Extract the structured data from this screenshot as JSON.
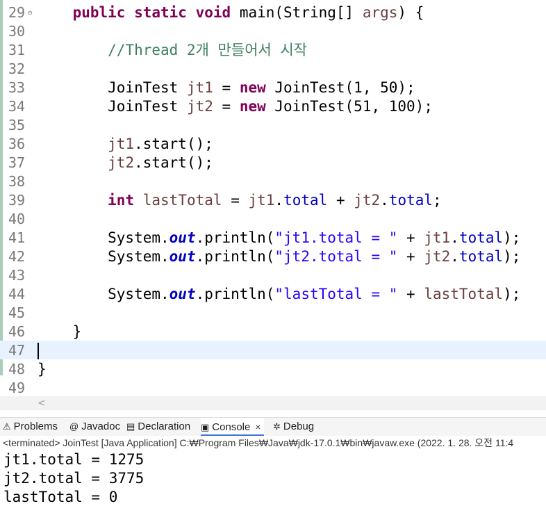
{
  "editor": {
    "lines": [
      {
        "num": "29",
        "folded": true,
        "tokens": [
          [
            "p",
            "    "
          ],
          [
            "kw",
            "public"
          ],
          [
            "p",
            " "
          ],
          [
            "kw",
            "static"
          ],
          [
            "p",
            " "
          ],
          [
            "kw",
            "void"
          ],
          [
            "p",
            " main(String[] "
          ],
          [
            "var",
            "args"
          ],
          [
            "p",
            ") {"
          ]
        ]
      },
      {
        "num": "30",
        "tokens": []
      },
      {
        "num": "31",
        "tokens": [
          [
            "p",
            "        "
          ],
          [
            "cmt",
            "//Thread 2개 만들어서 시작"
          ]
        ]
      },
      {
        "num": "32",
        "tokens": []
      },
      {
        "num": "33",
        "tokens": [
          [
            "p",
            "        JoinTest "
          ],
          [
            "var",
            "jt1"
          ],
          [
            "p",
            " = "
          ],
          [
            "kw",
            "new"
          ],
          [
            "p",
            " JoinTest(1, 50);"
          ]
        ]
      },
      {
        "num": "34",
        "tokens": [
          [
            "p",
            "        JoinTest "
          ],
          [
            "var",
            "jt2"
          ],
          [
            "p",
            " = "
          ],
          [
            "kw",
            "new"
          ],
          [
            "p",
            " JoinTest(51, 100);"
          ]
        ]
      },
      {
        "num": "35",
        "tokens": []
      },
      {
        "num": "36",
        "tokens": [
          [
            "p",
            "        "
          ],
          [
            "var",
            "jt1"
          ],
          [
            "p",
            ".start();"
          ]
        ]
      },
      {
        "num": "37",
        "tokens": [
          [
            "p",
            "        "
          ],
          [
            "var",
            "jt2"
          ],
          [
            "p",
            ".start();"
          ]
        ]
      },
      {
        "num": "38",
        "tokens": []
      },
      {
        "num": "39",
        "tokens": [
          [
            "p",
            "        "
          ],
          [
            "kw",
            "int"
          ],
          [
            "p",
            " "
          ],
          [
            "var",
            "lastTotal"
          ],
          [
            "p",
            " = "
          ],
          [
            "var",
            "jt1"
          ],
          [
            "p",
            "."
          ],
          [
            "fld",
            "total"
          ],
          [
            "p",
            " + "
          ],
          [
            "var",
            "jt2"
          ],
          [
            "p",
            "."
          ],
          [
            "fld",
            "total"
          ],
          [
            "p",
            ";"
          ]
        ]
      },
      {
        "num": "40",
        "tokens": []
      },
      {
        "num": "41",
        "tokens": [
          [
            "p",
            "        System."
          ],
          [
            "sfld",
            "out"
          ],
          [
            "p",
            ".println("
          ],
          [
            "str",
            "\"jt1.total = \""
          ],
          [
            "p",
            " + "
          ],
          [
            "var",
            "jt1"
          ],
          [
            "p",
            "."
          ],
          [
            "fld",
            "total"
          ],
          [
            "p",
            ");"
          ]
        ]
      },
      {
        "num": "42",
        "tokens": [
          [
            "p",
            "        System."
          ],
          [
            "sfld",
            "out"
          ],
          [
            "p",
            ".println("
          ],
          [
            "str",
            "\"jt2.total = \""
          ],
          [
            "p",
            " + "
          ],
          [
            "var",
            "jt2"
          ],
          [
            "p",
            "."
          ],
          [
            "fld",
            "total"
          ],
          [
            "p",
            ");"
          ]
        ]
      },
      {
        "num": "43",
        "tokens": []
      },
      {
        "num": "44",
        "tokens": [
          [
            "p",
            "        System."
          ],
          [
            "sfld",
            "out"
          ],
          [
            "p",
            ".println("
          ],
          [
            "str",
            "\"lastTotal = \""
          ],
          [
            "p",
            " + "
          ],
          [
            "var",
            "lastTotal"
          ],
          [
            "p",
            ");"
          ]
        ]
      },
      {
        "num": "45",
        "tokens": []
      },
      {
        "num": "46",
        "tokens": [
          [
            "p",
            "    }"
          ]
        ]
      },
      {
        "num": "47",
        "current": true,
        "tokens": []
      },
      {
        "num": "48",
        "tokens": [
          [
            "p",
            "}"
          ]
        ]
      },
      {
        "num": "49",
        "tokens": []
      }
    ]
  },
  "scrollbar": {
    "left_arrow": "<"
  },
  "tabs": [
    {
      "label": "Problems",
      "icon": "problems-icon",
      "glyph": "⚠",
      "active": false
    },
    {
      "label": "Javadoc",
      "icon": "javadoc-icon",
      "glyph": "@",
      "active": false
    },
    {
      "label": "Declaration",
      "icon": "declaration-icon",
      "glyph": "▤",
      "active": false
    },
    {
      "label": "Console",
      "icon": "console-icon",
      "glyph": "▣",
      "active": true
    },
    {
      "label": "Debug",
      "icon": "debug-icon",
      "glyph": "✲",
      "active": false
    }
  ],
  "close_glyph": "×",
  "status": "<terminated> JoinTest [Java Application] C:₩Program Files₩Java₩jdk-17.0.1₩bin₩javaw.exe  (2022. 1. 28. 오전 11:4",
  "console": [
    "jt1.total = 1275",
    "jt2.total = 3775",
    "lastTotal = 0"
  ],
  "colors": {
    "keyword": "#7f0055",
    "string": "#2a00ff",
    "comment": "#3f7f5f",
    "field": "#0000c0",
    "local": "#6a3e3e",
    "current_line": "#e8f2fe",
    "active_tab": "#3874d8"
  }
}
